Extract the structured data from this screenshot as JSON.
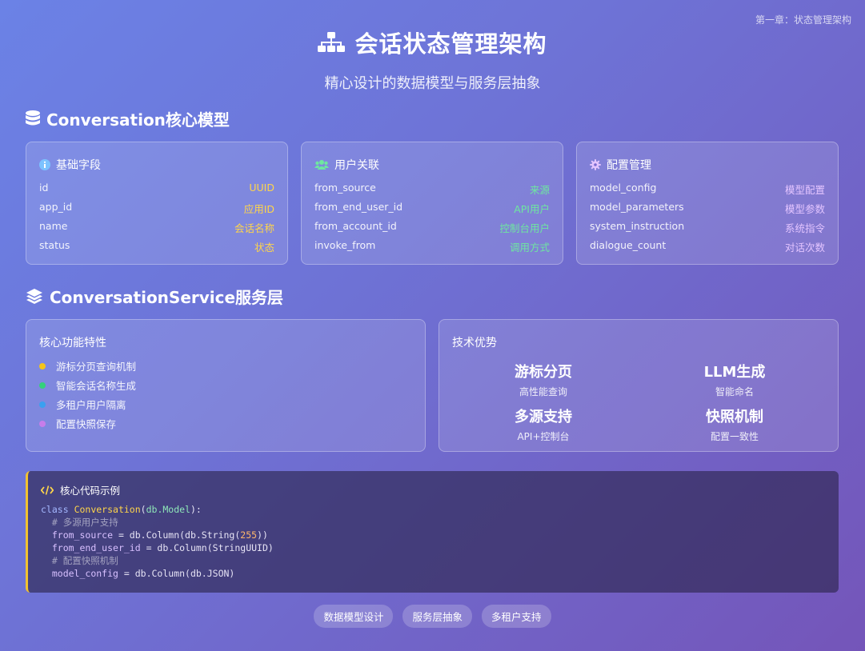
{
  "chapter": "第一章：状态管理架构",
  "header": {
    "title": "会话状态管理架构",
    "subtitle": "精心设计的数据模型与服务层抽象"
  },
  "model_section": {
    "title": "Conversation核心模型",
    "cards": [
      {
        "title": "基础字段",
        "icon": "info-icon",
        "rows": [
          {
            "key": "id",
            "value": "UUID"
          },
          {
            "key": "app_id",
            "value": "应用ID"
          },
          {
            "key": "name",
            "value": "会话名称"
          },
          {
            "key": "status",
            "value": "状态"
          }
        ]
      },
      {
        "title": "用户关联",
        "icon": "users-icon",
        "rows": [
          {
            "key": "from_source",
            "value": "来源"
          },
          {
            "key": "from_end_user_id",
            "value": "API用户"
          },
          {
            "key": "from_account_id",
            "value": "控制台用户"
          },
          {
            "key": "invoke_from",
            "value": "调用方式"
          }
        ]
      },
      {
        "title": "配置管理",
        "icon": "gear-icon",
        "rows": [
          {
            "key": "model_config",
            "value": "模型配置"
          },
          {
            "key": "model_parameters",
            "value": "模型参数"
          },
          {
            "key": "system_instruction",
            "value": "系统指令"
          },
          {
            "key": "dialogue_count",
            "value": "对话次数"
          }
        ]
      }
    ]
  },
  "service_section": {
    "title": "ConversationService服务层",
    "features_title": "核心功能特性",
    "features": [
      {
        "label": "游标分页查询机制",
        "color": "#f5c518"
      },
      {
        "label": "智能会话名称生成",
        "color": "#34d17a"
      },
      {
        "label": "多租户用户隔离",
        "color": "#3aa0f0"
      },
      {
        "label": "配置快照保存",
        "color": "#c77dea"
      }
    ],
    "advantages_title": "技术优势",
    "advantages": [
      {
        "title": "游标分页",
        "subtitle": "高性能查询"
      },
      {
        "title": "LLM生成",
        "subtitle": "智能命名"
      },
      {
        "title": "多源支持",
        "subtitle": "API+控制台"
      },
      {
        "title": "快照机制",
        "subtitle": "配置一致性"
      }
    ]
  },
  "code": {
    "title": "核心代码示例",
    "class_kw": "class",
    "class_name": "Conversation",
    "base": "db.Model",
    "comment1": "# 多源用户支持",
    "field1": "from_source",
    "field1_expr_a": " = db.Column(db.String(",
    "field1_num": "255",
    "field1_expr_b": "))",
    "field2": "from_end_user_id",
    "field2_expr": " = db.Column(StringUUID)",
    "comment2": "# 配置快照机制",
    "field3": "model_config",
    "field3_expr": " = db.Column(db.JSON)"
  },
  "tags": [
    "数据模型设计",
    "服务层抽象",
    "多租户支持"
  ]
}
